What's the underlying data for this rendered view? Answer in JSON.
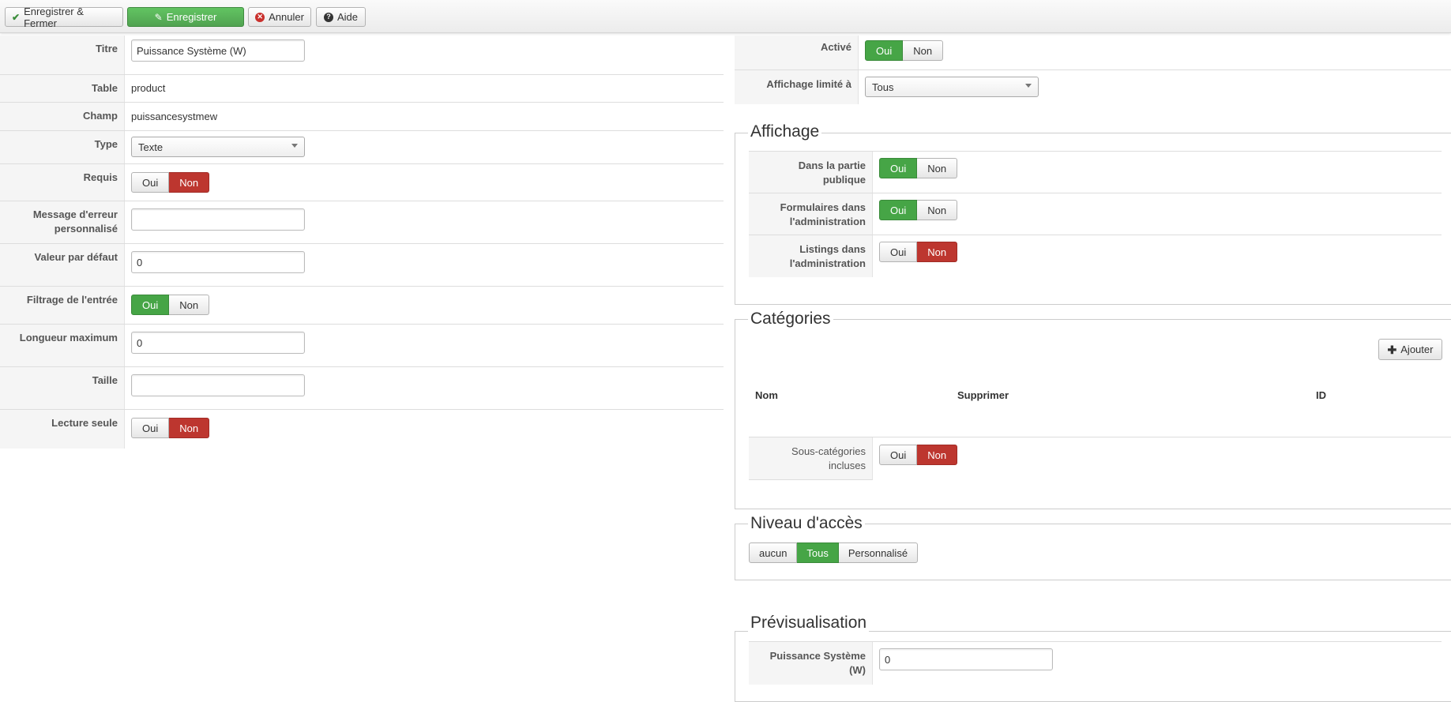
{
  "toolbar": {
    "save_close": "Enregistrer & Fermer",
    "save": "Enregistrer",
    "cancel": "Annuler",
    "help": "Aide"
  },
  "toggle": {
    "yes": "Oui",
    "no": "Non"
  },
  "left": {
    "titre_label": "Titre",
    "titre_value": "Puissance Système (W)",
    "table_label": "Table",
    "table_value": "product",
    "champ_label": "Champ",
    "champ_value": "puissancesystmew",
    "type_label": "Type",
    "type_value": "Texte",
    "requis_label": "Requis",
    "requis_value": "Non",
    "message_label_1": "Message d'erreur",
    "message_label_2": "personnalisé",
    "message_value": "",
    "defaut_label": "Valeur par défaut",
    "defaut_value": "0",
    "filtrage_label": "Filtrage de l'entrée",
    "filtrage_value": "Oui",
    "longueur_label": "Longueur maximum",
    "longueur_value": "0",
    "taille_label": "Taille",
    "taille_value": "",
    "lecture_label": "Lecture seule",
    "lecture_value": "Non"
  },
  "right": {
    "active_label": "Activé",
    "active_value": "Oui",
    "affichage_limite_label": "Affichage limité à",
    "affichage_limite_value": "Tous",
    "affichage": {
      "legend": "Affichage",
      "public_label_1": "Dans la partie",
      "public_label_2": "publique",
      "public_value": "Oui",
      "forms_label_1": "Formulaires dans",
      "forms_label_2": "l'administration",
      "forms_value": "Oui",
      "listings_label_1": "Listings dans",
      "listings_label_2": "l'administration",
      "listings_value": "Non"
    },
    "categories": {
      "legend": "Catégories",
      "add_button": "Ajouter",
      "col_nom": "Nom",
      "col_supprimer": "Supprimer",
      "col_id": "ID",
      "sub_label_1": "Sous-catégories",
      "sub_label_2": "incluses",
      "sub_value": "Non"
    },
    "acces": {
      "legend": "Niveau d'accès",
      "options": [
        "aucun",
        "Tous",
        "Personnalisé"
      ],
      "selected": "Tous"
    },
    "preview": {
      "legend": "Prévisualisation",
      "label_1": "Puissance Système",
      "label_2": "(W)",
      "value": "0"
    }
  },
  "colors": {
    "green": "#46a546",
    "red": "#bd362f"
  }
}
